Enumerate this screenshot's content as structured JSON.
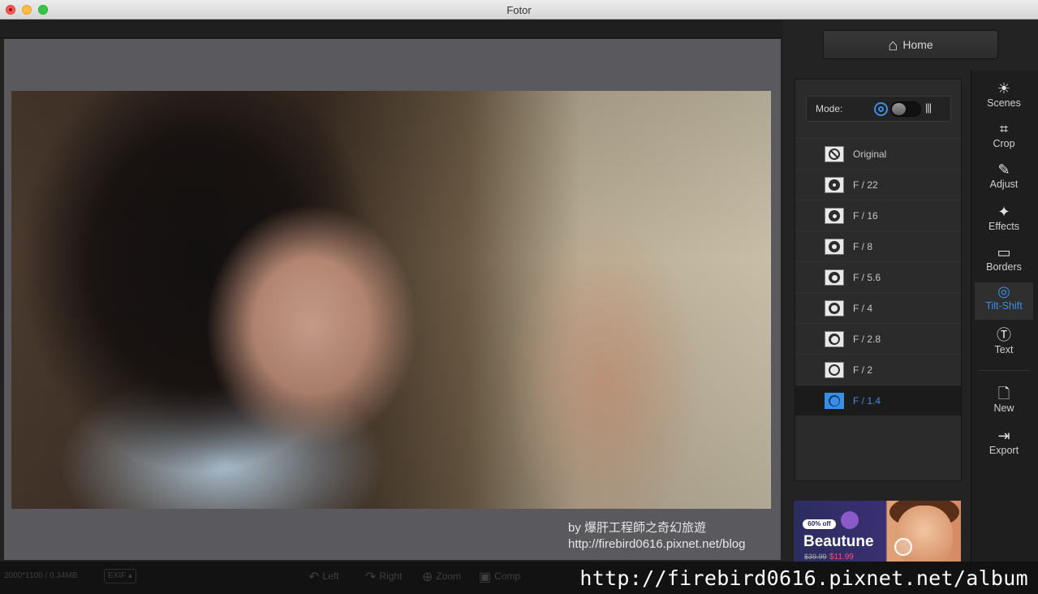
{
  "window": {
    "title": "Fotor"
  },
  "watermark": {
    "line1": "by 爆肝工程師之奇幻旅遊",
    "line2": "http://firebird0616.pixnet.net/blog"
  },
  "status": {
    "info": "2000*1100 / 0.34MB",
    "exif": "EXIF ▴",
    "tools": [
      {
        "label": "Left",
        "icon": "rotate-left-icon"
      },
      {
        "label": "Right",
        "icon": "rotate-right-icon"
      },
      {
        "label": "Zoom",
        "icon": "zoom-icon"
      },
      {
        "label": "Comp",
        "icon": "compare-icon"
      }
    ]
  },
  "url_overlay": "http://firebird0616.pixnet.net/album",
  "home": {
    "label": "Home",
    "icon": "home-icon"
  },
  "mode": {
    "label": "Mode:"
  },
  "presets": [
    {
      "label": "Original",
      "selected": false
    },
    {
      "label": "F / 22",
      "selected": false
    },
    {
      "label": "F / 16",
      "selected": false
    },
    {
      "label": "F / 8",
      "selected": false
    },
    {
      "label": "F / 5.6",
      "selected": false
    },
    {
      "label": "F / 4",
      "selected": false
    },
    {
      "label": "F / 2.8",
      "selected": false
    },
    {
      "label": "F / 2",
      "selected": false
    },
    {
      "label": "F / 1.4",
      "selected": true
    }
  ],
  "tools": [
    {
      "label": "Scenes",
      "icon": "sun-icon"
    },
    {
      "label": "Crop",
      "icon": "crop-icon"
    },
    {
      "label": "Adjust",
      "icon": "pencil-icon"
    },
    {
      "label": "Effects",
      "icon": "sparkle-icon"
    },
    {
      "label": "Borders",
      "icon": "frame-icon"
    },
    {
      "label": "Tilt-Shift",
      "icon": "target-icon",
      "selected": true
    },
    {
      "label": "Text",
      "icon": "text-icon"
    },
    {
      "label": "New",
      "icon": "document-icon"
    },
    {
      "label": "Export",
      "icon": "export-icon"
    }
  ],
  "ad": {
    "badge": "60% off",
    "title": "Beautune",
    "old_price": "$39.99",
    "new_price": "$11.99"
  },
  "colors": {
    "accent": "#3a8ee6",
    "panel": "#2b2b2c",
    "canvas": "#5a5a5e"
  }
}
